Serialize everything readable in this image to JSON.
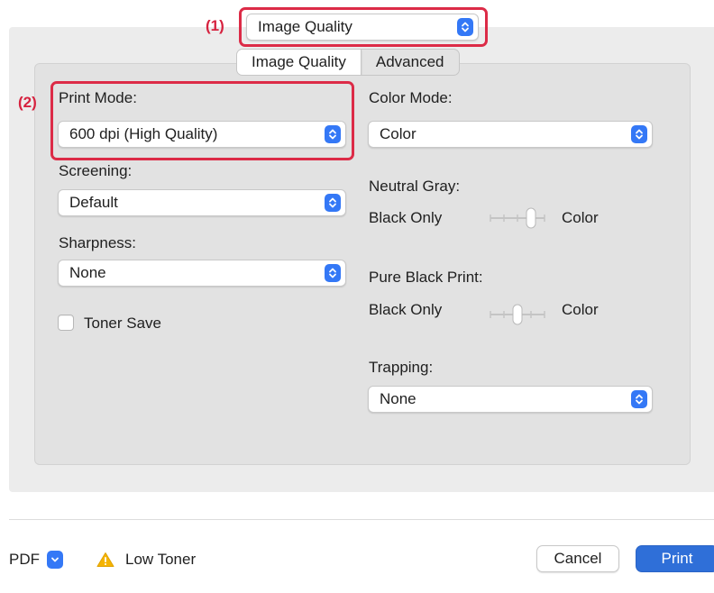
{
  "callouts": {
    "one": "(1)",
    "two": "(2)"
  },
  "panel_menu": {
    "value": "Image Quality"
  },
  "tabs": [
    {
      "label": "Image Quality",
      "active": true
    },
    {
      "label": "Advanced",
      "active": false
    }
  ],
  "left": {
    "print_mode": {
      "label": "Print Mode:",
      "value": "600 dpi (High Quality)"
    },
    "screening": {
      "label": "Screening:",
      "value": "Default"
    },
    "sharpness": {
      "label": "Sharpness:",
      "value": "None"
    },
    "toner_save": {
      "label": "Toner Save",
      "checked": false
    }
  },
  "right": {
    "color_mode": {
      "label": "Color Mode:",
      "value": "Color"
    },
    "neutral_gray": {
      "label": "Neutral Gray:",
      "min_label": "Black Only",
      "max_label": "Color",
      "level": 0.75
    },
    "pure_black": {
      "label": "Pure Black Print:",
      "min_label": "Black Only",
      "max_label": "Color",
      "level": 0.5
    },
    "trapping": {
      "label": "Trapping:",
      "value": "None"
    }
  },
  "footer": {
    "pdf_label": "PDF",
    "warning_text": "Low Toner",
    "cancel_label": "Cancel",
    "print_label": "Print"
  },
  "colors": {
    "accent": "#3478f6",
    "callout": "#dc2b47",
    "warning": "#f5b400"
  }
}
